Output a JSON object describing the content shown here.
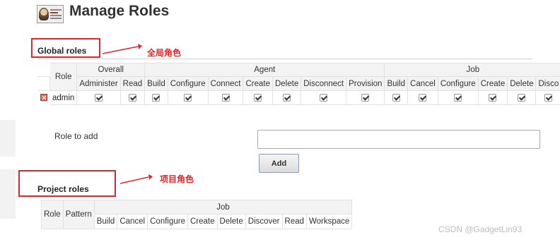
{
  "header": {
    "title": "Manage Roles",
    "icon": "jenkins-user-icon"
  },
  "global_roles": {
    "heading": "Global roles",
    "annotation": "全局角色",
    "table": {
      "role_header": "Role",
      "groups": [
        {
          "name": "Overall",
          "columns": [
            "Administer",
            "Read"
          ]
        },
        {
          "name": "Agent",
          "columns": [
            "Build",
            "Configure",
            "Connect",
            "Create",
            "Delete",
            "Disconnect",
            "Provision"
          ]
        },
        {
          "name": "Job",
          "columns": [
            "Build",
            "Cancel",
            "Configure",
            "Create",
            "Delete",
            "Disco"
          ]
        }
      ],
      "rows": [
        {
          "role": "admin",
          "checked": [
            true,
            true,
            true,
            true,
            true,
            true,
            true,
            true,
            true,
            true,
            true,
            true,
            true,
            true,
            true
          ]
        }
      ]
    }
  },
  "role_to_add": {
    "label": "Role to add",
    "value": "",
    "button": "Add"
  },
  "project_roles": {
    "heading": "Project roles",
    "annotation": "项目角色",
    "table": {
      "role_header": "Role",
      "pattern_header": "Pattern",
      "group": "Job",
      "columns": [
        "Build",
        "Cancel",
        "Configure",
        "Create",
        "Delete",
        "Discover",
        "Read",
        "Workspace"
      ]
    }
  },
  "footer_watermark": "CSDN @GadgetLin93"
}
